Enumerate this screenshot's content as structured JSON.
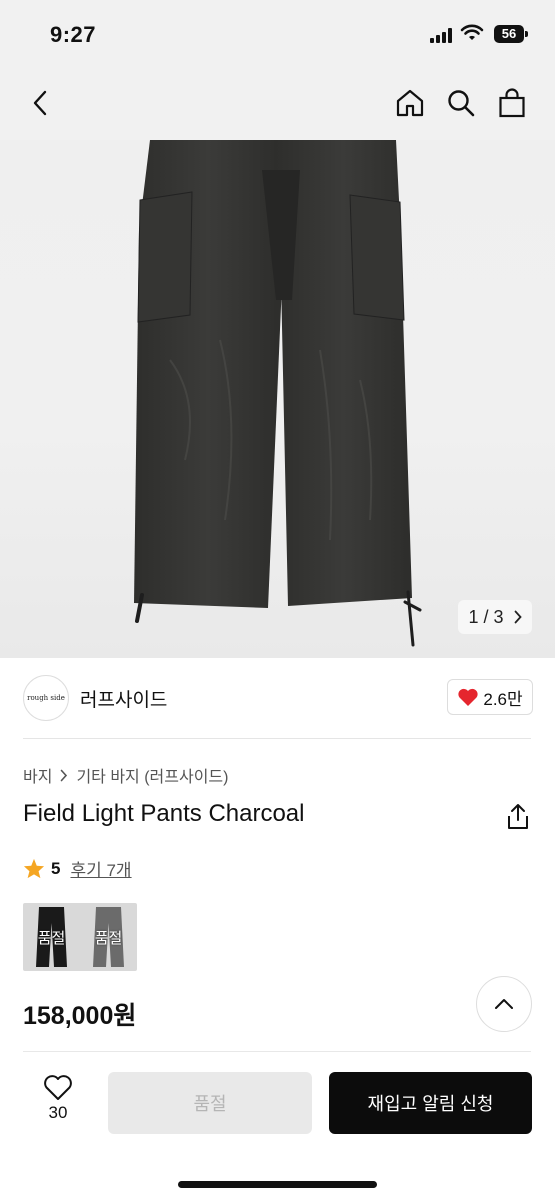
{
  "status_bar": {
    "time": "9:27",
    "battery": "56"
  },
  "nav": {
    "icons": [
      "back-icon",
      "home-icon",
      "search-icon",
      "shopping-bag-icon"
    ]
  },
  "gallery": {
    "current": "1",
    "separator": "/",
    "total": "3"
  },
  "brand": {
    "logo_text": "rough side",
    "name": "러프사이드",
    "likes": "2.6만"
  },
  "breadcrumb": {
    "level1": "바지",
    "level2": "기타 바지 (러프사이드)"
  },
  "product": {
    "title": "Field Light Pants Charcoal",
    "rating": "5",
    "reviews": "후기 7개",
    "price": "158,000원"
  },
  "options": [
    {
      "color": "#1a1a1a",
      "label": "품절"
    },
    {
      "color": "#6b6b6b",
      "label": "품절"
    }
  ],
  "bottom_bar": {
    "wish_count": "30",
    "soldout_label": "품절",
    "restock_label": "재입고 알림 신청"
  },
  "colors": {
    "accent": "#0c0c0c",
    "heart": "#e5262e",
    "star": "#f5a623"
  }
}
